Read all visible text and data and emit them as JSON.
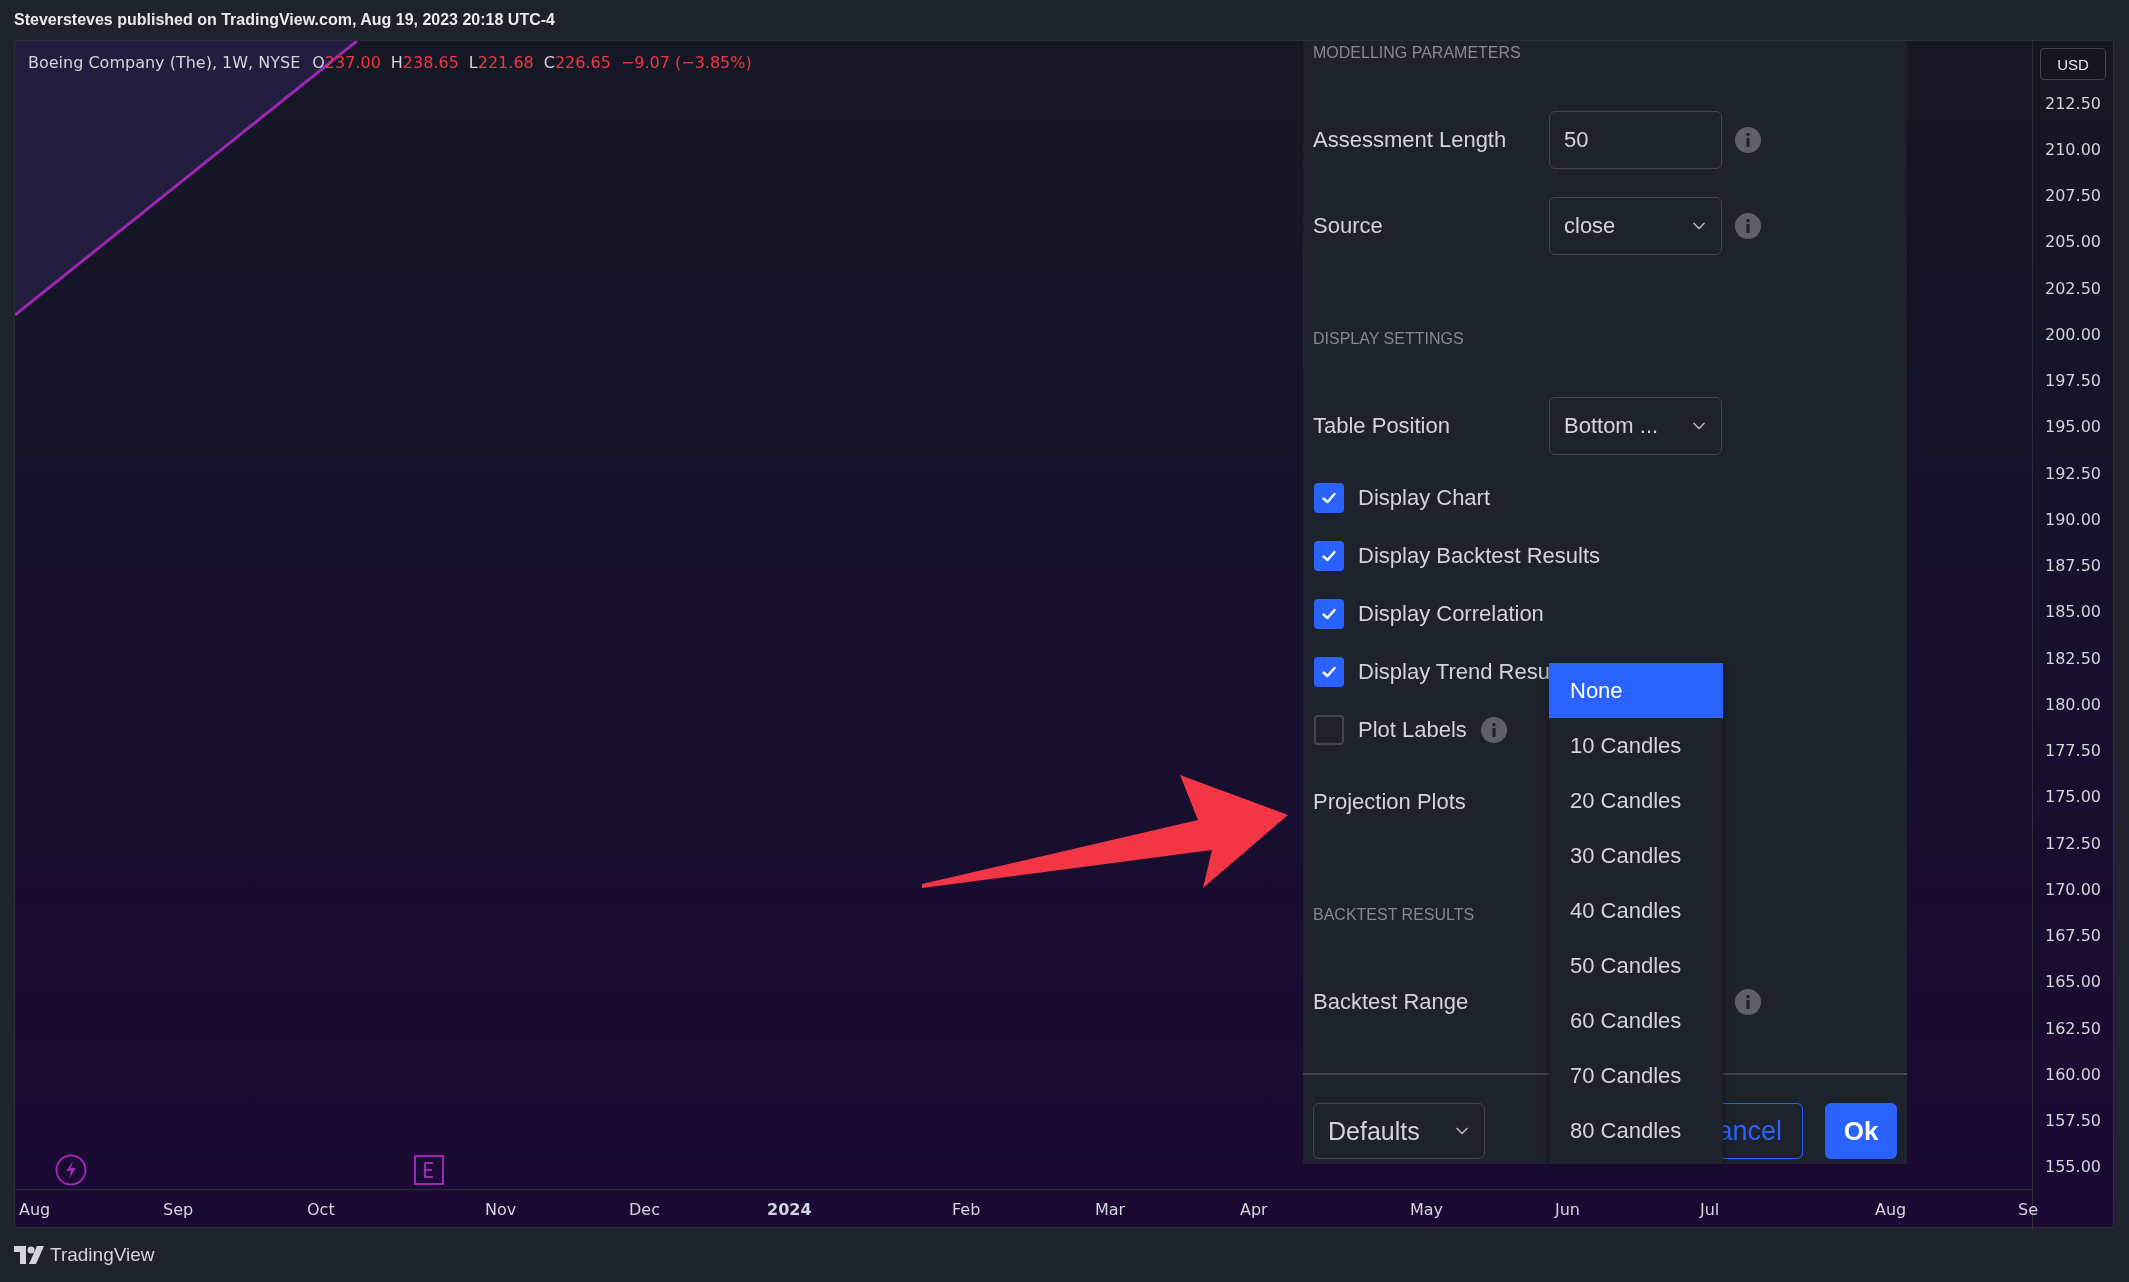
{
  "header": {
    "text": "Steversteves published on TradingView.com, Aug 19, 2023 20:18 UTC-4"
  },
  "legend": {
    "title": "Boeing Company (The), 1W, NYSE",
    "values": [
      {
        "label": "O",
        "value": "237.00"
      },
      {
        "label": "H",
        "value": "238.65"
      },
      {
        "label": "L",
        "value": "221.68"
      },
      {
        "label": "C",
        "value": "226.65"
      }
    ],
    "change": "−9.07 (−3.85%)"
  },
  "currency": "USD",
  "price_axis": [
    "212.50",
    "210.00",
    "207.50",
    "205.00",
    "202.50",
    "200.00",
    "197.50",
    "195.00",
    "192.50",
    "190.00",
    "187.50",
    "185.00",
    "182.50",
    "180.00",
    "177.50",
    "175.00",
    "172.50",
    "170.00",
    "167.50",
    "165.00",
    "162.50",
    "160.00",
    "157.50",
    "155.00"
  ],
  "time_axis": [
    {
      "label": "Aug",
      "bold": false
    },
    {
      "label": "Sep",
      "bold": false
    },
    {
      "label": "Oct",
      "bold": false
    },
    {
      "label": "Nov",
      "bold": false
    },
    {
      "label": "Dec",
      "bold": false
    },
    {
      "label": "2024",
      "bold": true
    },
    {
      "label": "Feb",
      "bold": false
    },
    {
      "label": "Mar",
      "bold": false
    },
    {
      "label": "Apr",
      "bold": false
    },
    {
      "label": "May",
      "bold": false
    },
    {
      "label": "Jun",
      "bold": false
    },
    {
      "label": "Jul",
      "bold": false
    },
    {
      "label": "Aug",
      "bold": false
    },
    {
      "label": "Se",
      "bold": false
    }
  ],
  "dialog": {
    "items": [
      {
        "kind": "heading",
        "text": "MODELLING PARAMETERS"
      },
      {
        "kind": "input",
        "label": "Assessment Length",
        "value": "50",
        "info": true
      },
      {
        "kind": "select",
        "label": "Source",
        "value": "close",
        "info": true
      },
      {
        "kind": "heading",
        "text": "DISPLAY SETTINGS"
      },
      {
        "kind": "select",
        "label": "Table Position",
        "value": "Bottom ...",
        "info": false
      },
      {
        "kind": "checkbox",
        "label": "Display Chart",
        "checked": true,
        "info": false
      },
      {
        "kind": "checkbox",
        "label": "Display Backtest Results",
        "checked": true,
        "info": false
      },
      {
        "kind": "checkbox",
        "label": "Display Correlation",
        "checked": true,
        "info": false
      },
      {
        "kind": "checkbox",
        "label": "Display Trend Resu",
        "checked": true,
        "info": false
      },
      {
        "kind": "checkbox",
        "label": "Plot Labels",
        "checked": false,
        "info": true
      },
      {
        "kind": "label",
        "label": "Projection Plots",
        "info": false
      },
      {
        "kind": "heading",
        "text": "BACKTEST RESULTS"
      },
      {
        "kind": "label",
        "label": "Backtest Range",
        "info": true
      }
    ],
    "footer": {
      "defaults": "Defaults",
      "cancel": "ancel",
      "ok": "Ok"
    }
  },
  "dropdown": {
    "options": [
      {
        "label": "None",
        "selected": true
      },
      {
        "label": "10 Candles",
        "selected": false
      },
      {
        "label": "20 Candles",
        "selected": false
      },
      {
        "label": "30 Candles",
        "selected": false
      },
      {
        "label": "40 Candles",
        "selected": false
      },
      {
        "label": "50 Candles",
        "selected": false
      },
      {
        "label": "60 Candles",
        "selected": false
      },
      {
        "label": "70 Candles",
        "selected": false
      },
      {
        "label": "80 Candles",
        "selected": false
      }
    ]
  },
  "footer": {
    "brand": "TradingView"
  }
}
